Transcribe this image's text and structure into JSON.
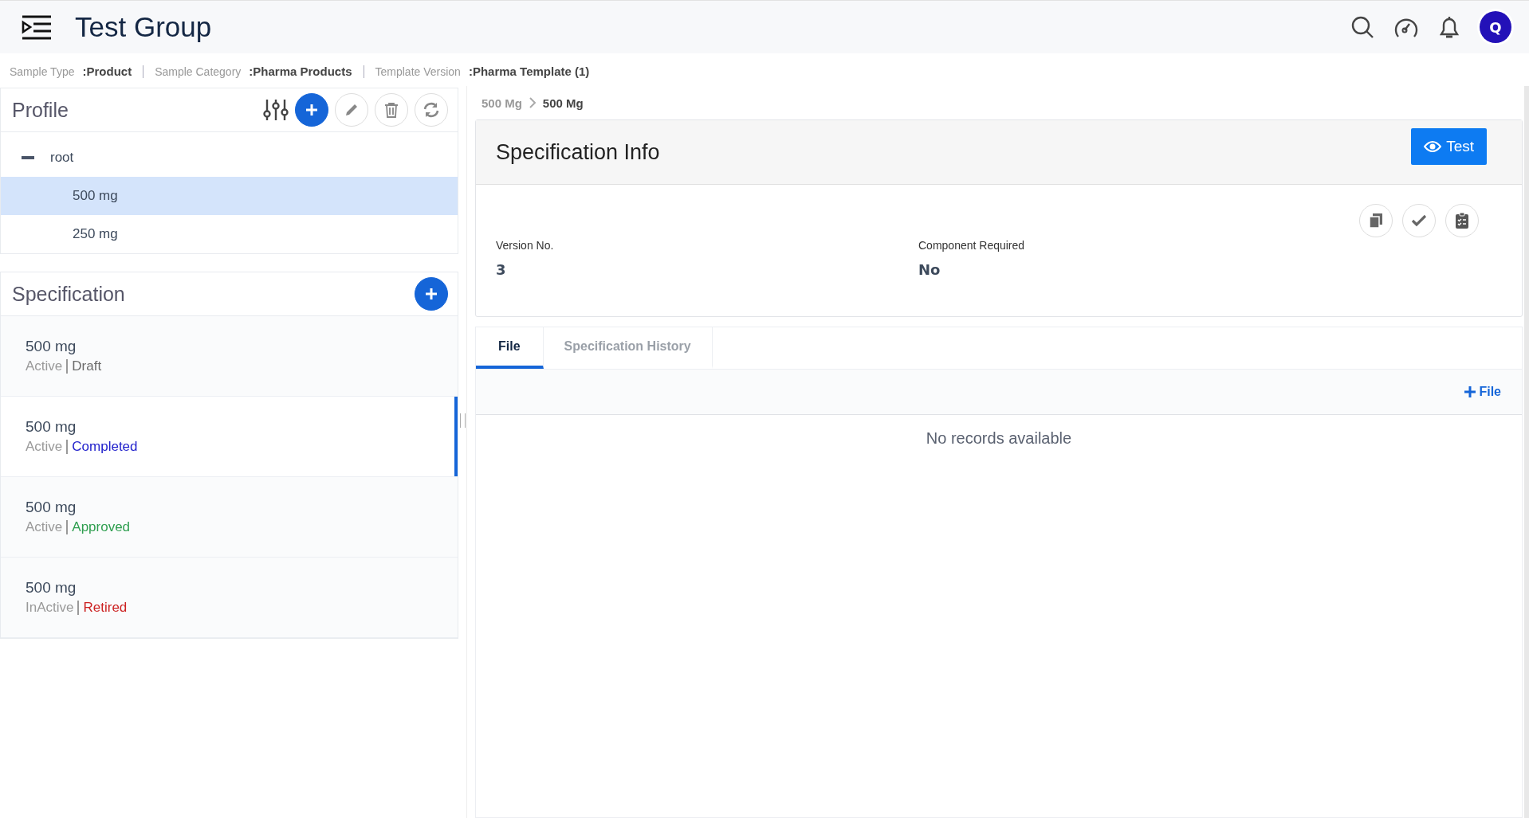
{
  "header": {
    "title": "Test Group",
    "avatar": "Q"
  },
  "meta": [
    {
      "label": "Sample Type",
      "value": ":Product"
    },
    {
      "label": "Sample Category",
      "value": ":Pharma Products"
    },
    {
      "label": "Template Version",
      "value": ":Pharma Template (1)"
    }
  ],
  "profile": {
    "title": "Profile",
    "tree": [
      {
        "label": "root",
        "expanded": true,
        "selected": false,
        "children": [
          {
            "label": "500 mg",
            "selected": true
          },
          {
            "label": "250 mg",
            "selected": false
          }
        ]
      }
    ]
  },
  "specification": {
    "title": "Specification",
    "items": [
      {
        "name": "500 mg",
        "state": "Active",
        "status": "Draft",
        "color": "#6b6b6b",
        "selected": false
      },
      {
        "name": "500 mg",
        "state": "Active",
        "status": "Completed",
        "color": "#2222cc",
        "selected": true
      },
      {
        "name": "500 mg",
        "state": "Active",
        "status": "Approved",
        "color": "#2e9e4f",
        "selected": false
      },
      {
        "name": "500 mg",
        "state": "InActive",
        "status": "Retired",
        "color": "#cc2222",
        "selected": false
      }
    ]
  },
  "breadcrumb": [
    "500 Mg",
    "500 Mg"
  ],
  "spec_info": {
    "title": "Specification Info",
    "button": "Test",
    "fields": [
      {
        "label": "Version No.",
        "value": "3"
      },
      {
        "label": "Component Required",
        "value": "No"
      }
    ]
  },
  "tabs": [
    {
      "label": "File",
      "selected": true
    },
    {
      "label": "Specification History",
      "selected": false
    }
  ],
  "file_button": "File",
  "empty_message": "No records available"
}
